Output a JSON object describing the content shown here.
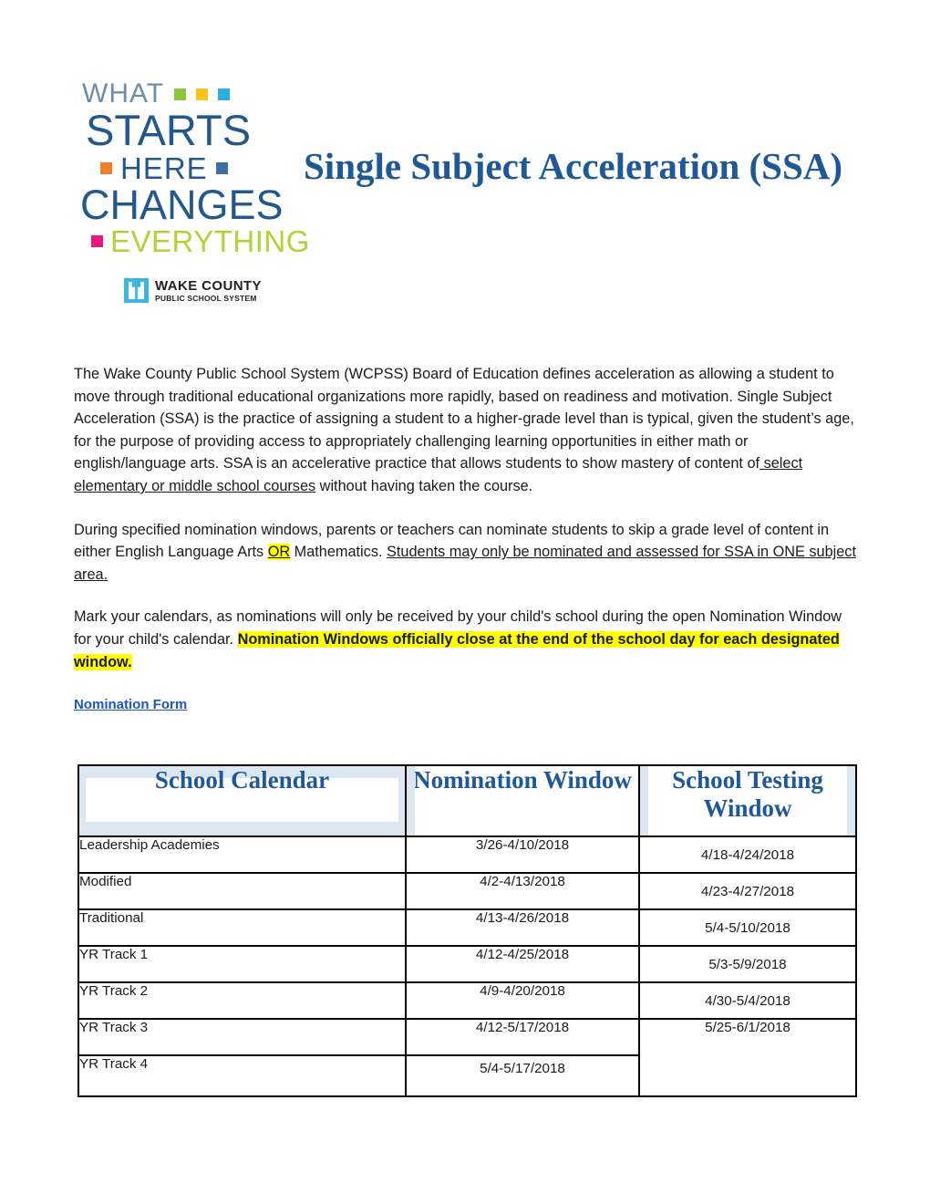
{
  "header": {
    "logo": {
      "line1": "WHAT",
      "line2": "STARTS",
      "line3": "HERE",
      "line4": "CHANGES",
      "line5": "EVERYTHING",
      "org_name": "WAKE COUNTY",
      "org_sub": "PUBLIC SCHOOL SYSTEM",
      "colors": {
        "what": "#6e8fa3",
        "starts": "#23588a",
        "here": "#23588a",
        "changes": "#23588a",
        "everything": "#b4d233",
        "square_green": "#8cc63e",
        "square_yellow": "#fbc418",
        "square_cyan": "#2eaedb",
        "square_orange": "#f07f29",
        "square_blue": "#3b6ea5",
        "square_pink": "#e6187d",
        "wcpss_blue": "#3ab6e5"
      }
    },
    "title": "Single Subject Acceleration (SSA)",
    "title_color": "#1f5897"
  },
  "body": {
    "paragraph1": {
      "part_a": "The Wake County Public School System (WCPSS) Board of Education defines acceleration as allowing a student to move through traditional educational organizations more rapidly, based on readiness and motivation. Single Subject Acceleration (SSA) is the practice of assigning a student to a higher-grade level than is typical, given the student’s age, for the purpose of providing access to appropriately challenging learning opportunities in either math or english/language arts.   SSA is an accelerative practice that allows students to show mastery of content of",
      "underlined": " select elementary or middle school courses",
      "part_b": " without having taken the course."
    },
    "paragraph2": {
      "part_a": "During specified nomination windows, parents or teachers can nominate students to skip a grade level of content in either English Language Arts ",
      "highlight_or": "OR",
      "part_b": " Mathematics.  ",
      "underlined": "Students may only be nominated and assessed for SSA in ONE subject area. "
    },
    "paragraph3": {
      "part_a": "Mark your calendars, as nominations will only be received by your child's school during the open Nomination Window for your child's calendar. ",
      "highlighted_bold": "Nomination Windows officially close at the end of the school day for each designated window."
    },
    "nomination_form_link": "Nomination Form",
    "link_color": "#1a57c4",
    "highlight_color": "#ffff00"
  },
  "table": {
    "headers": {
      "calendar": "School Calendar",
      "nomination": "Nomination Window",
      "testing": "School Testing Window"
    },
    "rows": [
      {
        "calendar": "Leadership Academies",
        "nomination": "3/26-4/10/2018",
        "testing": "4/18-4/24/2018"
      },
      {
        "calendar": "Modified",
        "nomination": "4/2-4/13/2018",
        "testing": "4/23-4/27/2018"
      },
      {
        "calendar": "Traditional",
        "nomination": "4/13-4/26/2018",
        "testing": "5/4-5/10/2018"
      },
      {
        "calendar": "YR Track 1",
        "nomination": "4/12-4/25/2018",
        "testing": "5/3-5/9/2018"
      },
      {
        "calendar": "YR Track 2",
        "nomination": "4/9-4/20/2018",
        "testing": "4/30-5/4/2018"
      },
      {
        "calendar": "YR Track 3",
        "nomination": "4/12-5/17/2018",
        "testing": "5/25-6/1/2018"
      },
      {
        "calendar": "YR Track 4",
        "nomination": "5/4-5/17/2018",
        "testing": ""
      }
    ],
    "merged_testing_value": "5/25-6/1/2018",
    "header_fill": "#dce6f1",
    "header_text_color": "#1f5897"
  }
}
